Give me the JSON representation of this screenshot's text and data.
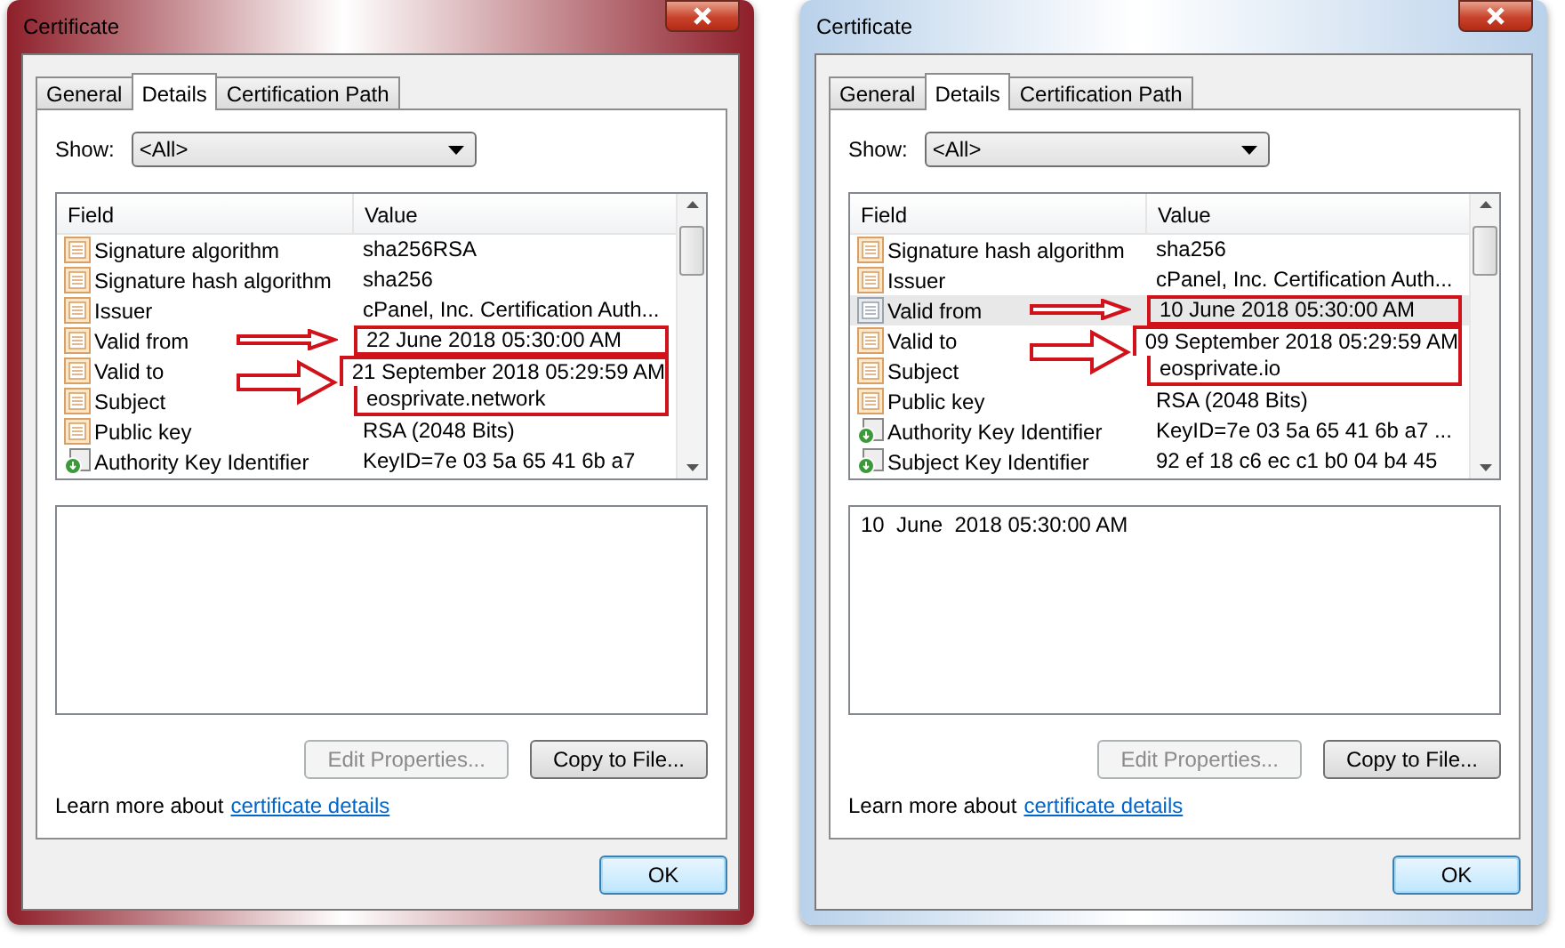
{
  "dialogs": [
    {
      "title": "Certificate",
      "color": "#8e1f2a",
      "tabs": [
        {
          "label": "General",
          "selected": false
        },
        {
          "label": "Details",
          "selected": true
        },
        {
          "label": "Certification Path",
          "selected": false
        }
      ],
      "show": {
        "label": "Show:",
        "value": "<All>"
      },
      "columns": [
        "Field",
        "Value"
      ],
      "rows": [
        {
          "field": "Signature algorithm",
          "value": "sha256RSA",
          "kind": "property",
          "selected": false,
          "highlighted": false
        },
        {
          "field": "Signature hash algorithm",
          "value": "sha256",
          "kind": "property",
          "selected": false,
          "highlighted": false
        },
        {
          "field": "Issuer",
          "value": "cPanel, Inc. Certification Auth...",
          "kind": "property",
          "selected": false,
          "highlighted": false
        },
        {
          "field": "Valid from",
          "value": "22 June 2018 05:30:00 AM",
          "kind": "property",
          "selected": false,
          "highlighted": true,
          "joined_with_next": false
        },
        {
          "field": "Valid to",
          "value": "21 September 2018 05:29:59 AM",
          "kind": "property",
          "selected": false,
          "highlighted": true,
          "joined_with_next": true
        },
        {
          "field": "Subject",
          "value": "eosprivate.network",
          "kind": "property",
          "selected": false,
          "highlighted": true,
          "joined_with_next": false
        },
        {
          "field": "Public key",
          "value": "RSA (2048 Bits)",
          "kind": "property",
          "selected": false,
          "highlighted": false
        },
        {
          "field": "Authority Key Identifier",
          "value": "KeyID=7e 03 5a 65 41 6b a7",
          "kind": "extension",
          "selected": false,
          "highlighted": false
        }
      ],
      "buttons": [
        {
          "label": "Edit Properties...",
          "disabled": true
        },
        {
          "label": "Copy to File...",
          "disabled": false
        }
      ],
      "learn_more": {
        "text": "Learn more about",
        "link": "certificate details"
      },
      "ok": "OK"
    },
    {
      "title": "Certificate",
      "color": "#b9d1ea",
      "tabs": [
        {
          "label": "General",
          "selected": false
        },
        {
          "label": "Details",
          "selected": true
        },
        {
          "label": "Certification Path",
          "selected": false
        }
      ],
      "show": {
        "label": "Show:",
        "value": "<All>"
      },
      "columns": [
        "Field",
        "Value"
      ],
      "rows": [
        {
          "field": "Signature hash algorithm",
          "value": "sha256",
          "kind": "property",
          "selected": false,
          "highlighted": false
        },
        {
          "field": "Issuer",
          "value": "cPanel, Inc. Certification Auth...",
          "kind": "property",
          "selected": false,
          "highlighted": false
        },
        {
          "field": "Valid from",
          "value": "10 June 2018 05:30:00 AM",
          "kind": "property",
          "selected": true,
          "highlighted": true,
          "joined_with_next": false
        },
        {
          "field": "Valid to",
          "value": "09 September 2018 05:29:59 AM",
          "kind": "property",
          "selected": false,
          "highlighted": true,
          "joined_with_next": true
        },
        {
          "field": "Subject",
          "value": "eosprivate.io",
          "kind": "property",
          "selected": false,
          "highlighted": true,
          "joined_with_next": false
        },
        {
          "field": "Public key",
          "value": "RSA (2048 Bits)",
          "kind": "property",
          "selected": false,
          "highlighted": false
        },
        {
          "field": "Authority Key Identifier",
          "value": "KeyID=7e 03 5a 65 41 6b a7 ...",
          "kind": "extension",
          "selected": false,
          "highlighted": false
        },
        {
          "field": "Subject Key Identifier",
          "value": "92 ef 18 c6 ec c1 b0 04 b4 45",
          "kind": "extension",
          "selected": false,
          "highlighted": false
        }
      ],
      "detail": "10  June  2018 05:30:00 AM",
      "buttons": [
        {
          "label": "Edit Properties...",
          "disabled": true
        },
        {
          "label": "Copy to File...",
          "disabled": false
        }
      ],
      "learn_more": {
        "text": "Learn more about",
        "link": "certificate details"
      },
      "ok": "OK"
    }
  ]
}
